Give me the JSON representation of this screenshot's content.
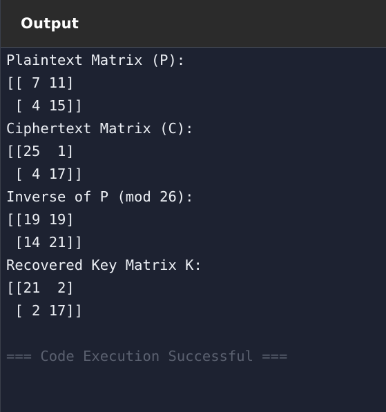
{
  "header": {
    "title": "Output"
  },
  "output": {
    "lines": [
      "Plaintext Matrix (P):",
      "[[ 7 11]",
      " [ 4 15]]",
      "Ciphertext Matrix (C):",
      "[[25  1]",
      " [ 4 17]]",
      "Inverse of P (mod 26):",
      "[[19 19]",
      " [14 21]]",
      "Recovered Key Matrix K:",
      "[[21  2]",
      " [ 2 17]]"
    ],
    "status": "=== Code Execution Successful ==="
  },
  "colors": {
    "background": "#1d2231",
    "header_background": "#2b2b2b",
    "text": "#eceff4",
    "status_text": "#5b6170"
  }
}
